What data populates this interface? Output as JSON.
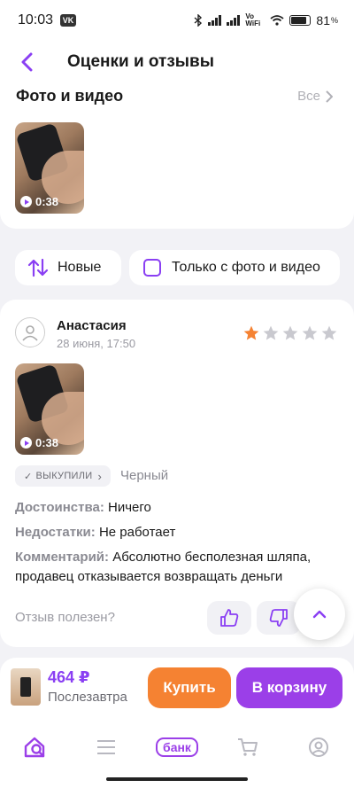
{
  "status": {
    "time": "10:03",
    "app_badge": "VK",
    "wifi_label": "Vo WiFi",
    "battery": "81"
  },
  "header": {
    "title": "Оценки и отзывы"
  },
  "photos": {
    "title": "Фото и видео",
    "see_all": "Все",
    "video_duration": "0:38"
  },
  "filters": {
    "sort_label": "Новые",
    "photo_only_label": "Только с фото и видео",
    "photo_only_checked": false
  },
  "review": {
    "author": "Анастасия",
    "date": "28 июня, 17:50",
    "rating": 1,
    "max_rating": 5,
    "video_duration": "0:38",
    "bought_badge": "ВЫКУПИЛИ",
    "color": "Черный",
    "pros_label": "Достоинства:",
    "pros": "Ничего",
    "cons_label": "Недостатки:",
    "cons": "Не работает",
    "comment_label": "Комментарий:",
    "comment": "Абсолютно бесполезная шляпа, продавец отказывается возвращать деньги",
    "helpful_question": "Отзыв полезен?"
  },
  "buy_bar": {
    "price": "464 ₽",
    "delivery": "Послезавтра",
    "buy_label": "Купить",
    "cart_label": "В корзину"
  },
  "nav": {
    "bank_label": "банк"
  },
  "colors": {
    "accent": "#9b3fe8",
    "orange": "#f58232",
    "star_active": "#f58232",
    "star_inactive": "#c9c9cf"
  }
}
